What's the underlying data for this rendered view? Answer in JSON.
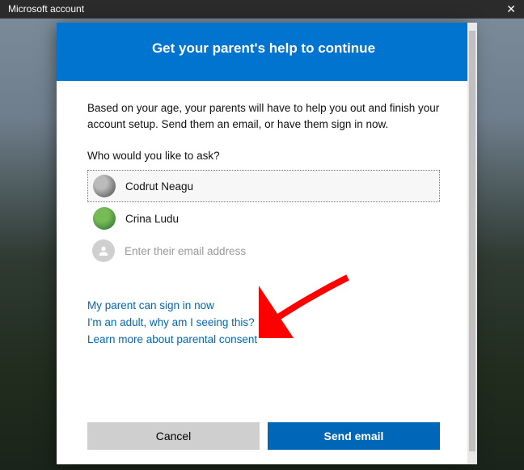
{
  "titlebar": {
    "label": "Microsoft account"
  },
  "header": {
    "title": "Get your parent's help to continue"
  },
  "body": {
    "intro": "Based on your age, your parents will have to help you out and finish your account setup. Send them an email, or have them sign in now.",
    "prompt": "Who would you like to ask?"
  },
  "parents": [
    {
      "name": "Codrut Neagu",
      "selected": true
    },
    {
      "name": "Crina Ludu",
      "selected": false
    }
  ],
  "email": {
    "placeholder": "Enter their email address"
  },
  "links": {
    "signin": "My parent can sign in now",
    "adult": "I'm an adult, why am I seeing this?",
    "learn": "Learn more about parental consent"
  },
  "buttons": {
    "cancel": "Cancel",
    "send": "Send email"
  }
}
